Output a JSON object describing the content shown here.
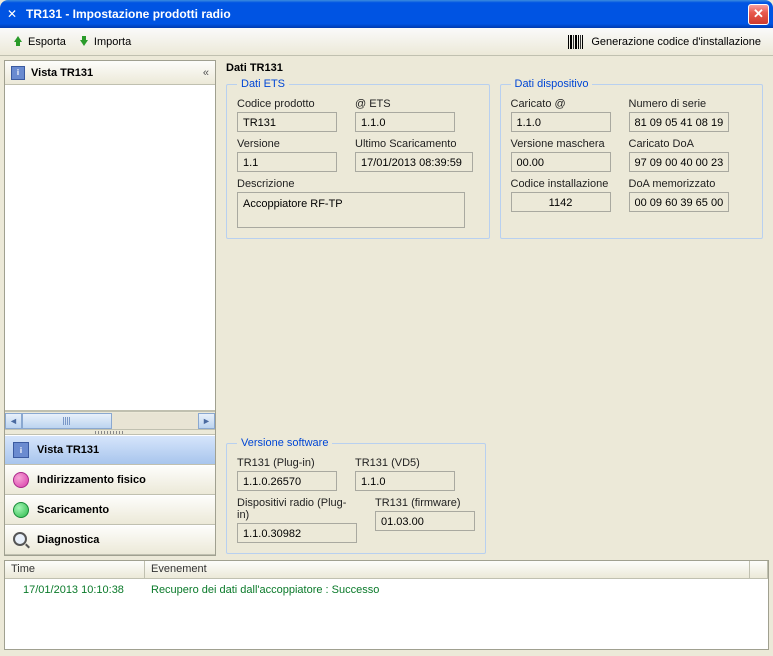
{
  "window": {
    "title": "TR131 - Impostazione prodotti radio"
  },
  "toolbar": {
    "export_label": "Esporta",
    "import_label": "Importa",
    "gen_code_label": "Generazione codice d'installazione"
  },
  "sidebar": {
    "header": "Vista TR131",
    "collapse_glyph": "«",
    "items": [
      {
        "label": "Vista TR131"
      },
      {
        "label": "Indirizzamento fisico"
      },
      {
        "label": "Scaricamento"
      },
      {
        "label": "Diagnostica"
      }
    ]
  },
  "main": {
    "title": "Dati TR131",
    "ets": {
      "legend": "Dati ETS",
      "product_code_label": "Codice prodotto",
      "product_code": "TR131",
      "at_ets_label": "@ ETS",
      "at_ets": "1.1.0",
      "version_label": "Versione",
      "version": "1.1",
      "last_dl_label": "Ultimo Scaricamento",
      "last_dl": "17/01/2013 08:39:59",
      "desc_label": "Descrizione",
      "desc": "Accoppiatore RF-TP"
    },
    "device": {
      "legend": "Dati dispositivo",
      "loaded_at_label": "Caricato @",
      "loaded_at": "1.1.0",
      "serial_label": "Numero di serie",
      "serial": "81 09 05 41 08 19",
      "mask_label": "Versione maschera",
      "mask": "00.00",
      "doa_loaded_label": "Caricato DoA",
      "doa_loaded": "97 09 00 40 00 23",
      "install_code_label": "Codice installazione",
      "install_code": "1142",
      "doa_stored_label": "DoA memorizzato",
      "doa_stored": "00 09 60 39 65 00"
    },
    "sw": {
      "legend": "Versione software",
      "plugin_label": "TR131 (Plug-in)",
      "plugin": "1.1.0.26570",
      "vd5_label": "TR131 (VD5)",
      "vd5": "1.1.0",
      "radio_plugin_label": "Dispositivi radio (Plug-in)",
      "radio_plugin": "1.1.0.30982",
      "firmware_label": "TR131 (firmware)",
      "firmware": "01.03.00"
    }
  },
  "log": {
    "col_time": "Time",
    "col_event": "Evenement",
    "rows": [
      {
        "time": "17/01/2013 10:10:38",
        "event": "Recupero dei dati dall'accoppiatore : Successo"
      }
    ]
  }
}
